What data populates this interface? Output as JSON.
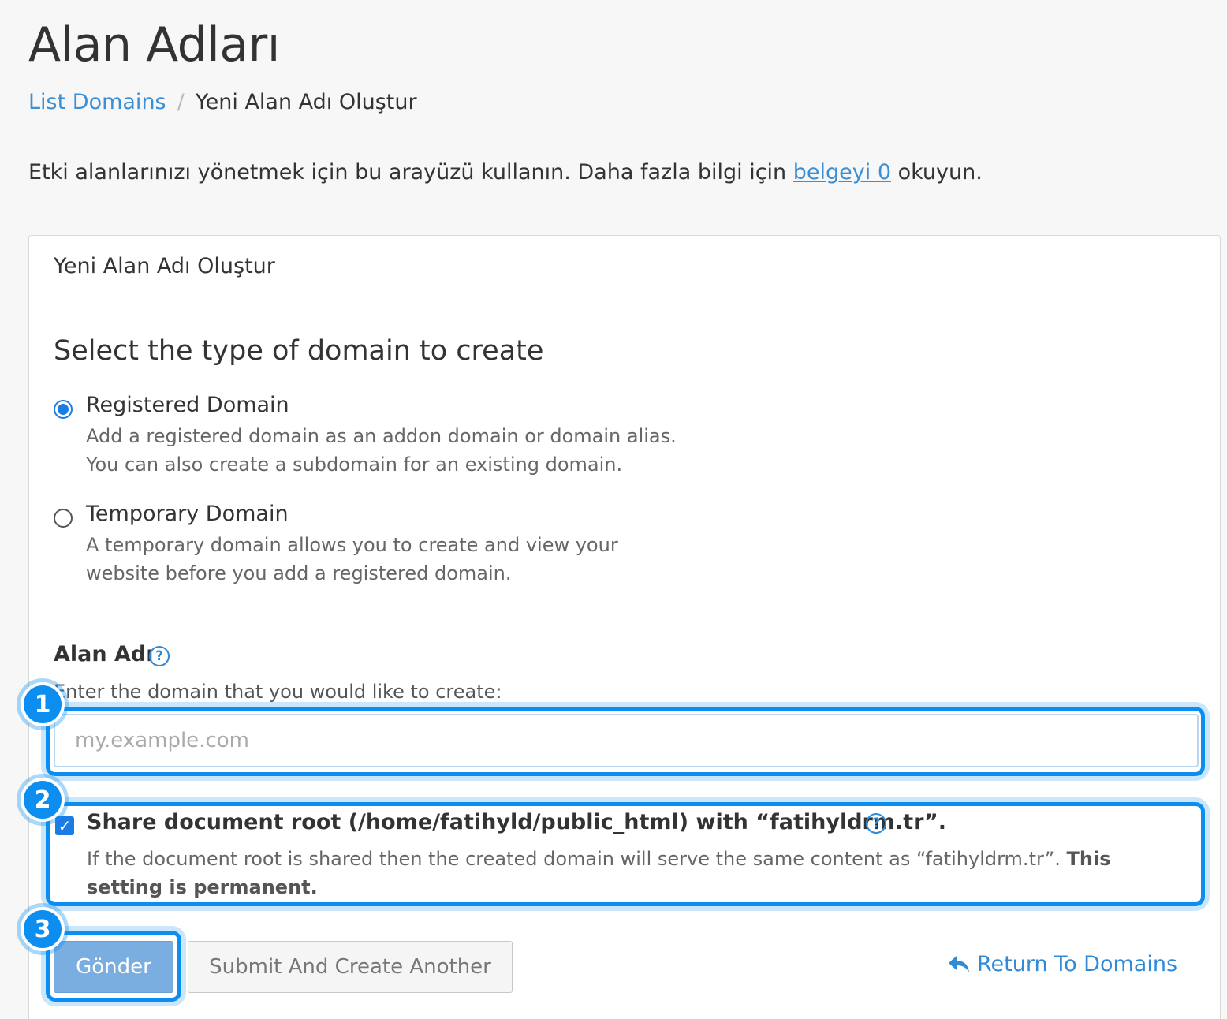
{
  "page": {
    "title": "Alan Adları",
    "breadcrumb": {
      "link": "List Domains",
      "separator": "/",
      "current": "Yeni Alan Adı Oluştur"
    },
    "intro": {
      "before": "Etki alanlarınızı yönetmek için bu arayüzü kullanın. Daha fazla bilgi için ",
      "link": "belgeyi 0",
      "after": " okuyun."
    }
  },
  "panel": {
    "header": "Yeni Alan Adı Oluştur",
    "section_heading": "Select the type of domain to create",
    "options": [
      {
        "title": "Registered Domain",
        "desc1": "Add a registered domain as an addon domain or domain alias.",
        "desc2": "You can also create a subdomain for an existing domain.",
        "selected": true
      },
      {
        "title": "Temporary Domain",
        "desc1": "A temporary domain allows you to create and view your",
        "desc2": "website before you add a registered domain.",
        "selected": false
      }
    ],
    "domain_field": {
      "label": "Alan Adı",
      "help_icon": "question-circle-icon",
      "hint": "Enter the domain that you would like to create:",
      "placeholder": "my.example.com",
      "value": ""
    },
    "share_root": {
      "checked": true,
      "label": "Share document root (/home/fatihyld/public_html) with “fatihyldrm.tr”.",
      "desc": "If the document root is shared then the created domain will serve the same content as “fatihyldrm.tr”. ",
      "desc_bold": "This setting is permanent."
    },
    "buttons": {
      "submit": "Gönder",
      "submit_another": "Submit And Create Another",
      "return": "Return To Domains",
      "return_icon": "reply-arrow-icon"
    }
  },
  "callouts": [
    "1",
    "2",
    "3"
  ],
  "colors": {
    "accent": "#0b8ef0",
    "link": "#3a8fd6",
    "primary_button": "#7aade0"
  }
}
